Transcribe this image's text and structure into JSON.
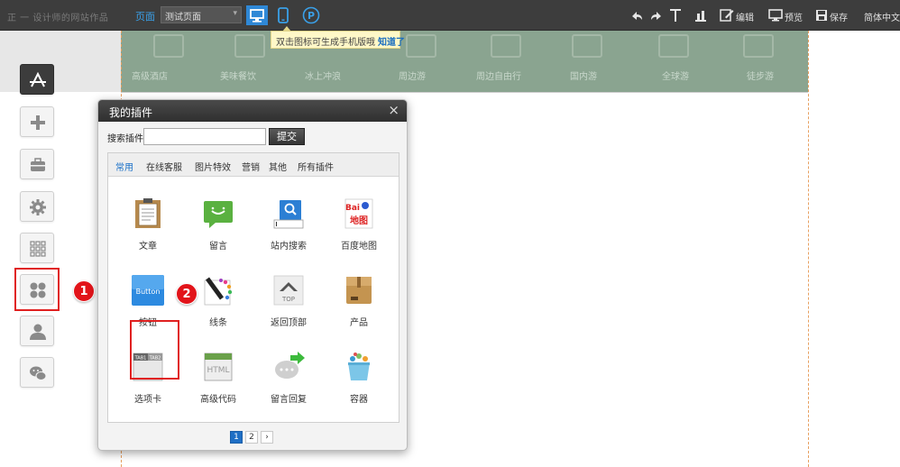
{
  "toolbar": {
    "site_name": "正 一 设计师的网站作品",
    "page_label": "页面",
    "page_select": "测试页面",
    "tooltip_text": "双击图标可生成手机版哦",
    "tooltip_ok": "知道了",
    "edit_label": "编辑",
    "preview_label": "预览",
    "save_label": "保存",
    "language_label": "简体中文"
  },
  "banner": {
    "nav_items": [
      "高级酒店",
      "美味餐饮",
      "冰上冲浪",
      "周边游",
      "周边自由行",
      "国内游",
      "全球游",
      "徒步游"
    ]
  },
  "annotations": {
    "step1": "1",
    "step2": "2"
  },
  "dialog": {
    "title": "我的插件",
    "close": "×",
    "search_label": "搜索插件",
    "search_value": "",
    "search_placeholder": "",
    "submit_label": "提交",
    "tabs": [
      "常用",
      "在线客服",
      "图片特效",
      "营销",
      "其他",
      "所有插件"
    ],
    "active_tab": "常用",
    "plugins": [
      {
        "label": "文章",
        "icon": "article-icon"
      },
      {
        "label": "留言",
        "icon": "message-icon"
      },
      {
        "label": "站内搜索",
        "icon": "site-search-icon"
      },
      {
        "label": "百度地图",
        "icon": "baidu-map-icon"
      },
      {
        "label": "按钮",
        "icon": "button-icon"
      },
      {
        "label": "线条",
        "icon": "line-icon"
      },
      {
        "label": "返回顶部",
        "icon": "back-to-top-icon"
      },
      {
        "label": "产品",
        "icon": "product-icon"
      },
      {
        "label": "选项卡",
        "icon": "tabs-icon"
      },
      {
        "label": "高级代码",
        "icon": "html-code-icon"
      },
      {
        "label": "留言回复",
        "icon": "message-reply-icon"
      },
      {
        "label": "容器",
        "icon": "container-icon"
      }
    ],
    "icon_texts": {
      "button": "Button",
      "baidu_top": "Bai",
      "baidu_bottom": "地图",
      "top": "TOP",
      "html": "HTML",
      "tab1": "TAB1",
      "tab2": "TAB2"
    },
    "pager": {
      "pages": [
        "1",
        "2"
      ],
      "next": "›",
      "current": "1"
    }
  },
  "colors": {
    "accent_blue": "#1f6fc5",
    "highlight_red": "#e02020",
    "toolbar_bg": "#3d3d3d"
  }
}
